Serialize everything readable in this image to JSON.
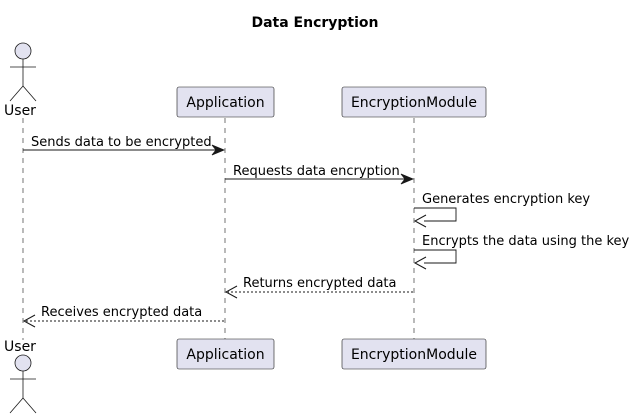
{
  "title": "Data Encryption",
  "participants": {
    "user": {
      "label": "User",
      "kind": "actor"
    },
    "application": {
      "label": "Application",
      "kind": "participant"
    },
    "encryption_module": {
      "label": "EncryptionModule",
      "kind": "participant"
    }
  },
  "messages": [
    {
      "from": "user",
      "to": "application",
      "text": "Sends data to be encrypted",
      "style": "solid"
    },
    {
      "from": "application",
      "to": "encryption_module",
      "text": "Requests data encryption",
      "style": "solid"
    },
    {
      "from": "encryption_module",
      "to": "encryption_module",
      "text": "Generates encryption key",
      "style": "solid"
    },
    {
      "from": "encryption_module",
      "to": "encryption_module",
      "text": "Encrypts the data using the key",
      "style": "solid"
    },
    {
      "from": "encryption_module",
      "to": "application",
      "text": "Returns encrypted data",
      "style": "dashed"
    },
    {
      "from": "application",
      "to": "user",
      "text": "Receives encrypted data",
      "style": "dashed"
    }
  ],
  "colors": {
    "participant_fill": "#e2e2f0",
    "line": "#181818",
    "text": "#000000",
    "background": "#ffffff"
  }
}
